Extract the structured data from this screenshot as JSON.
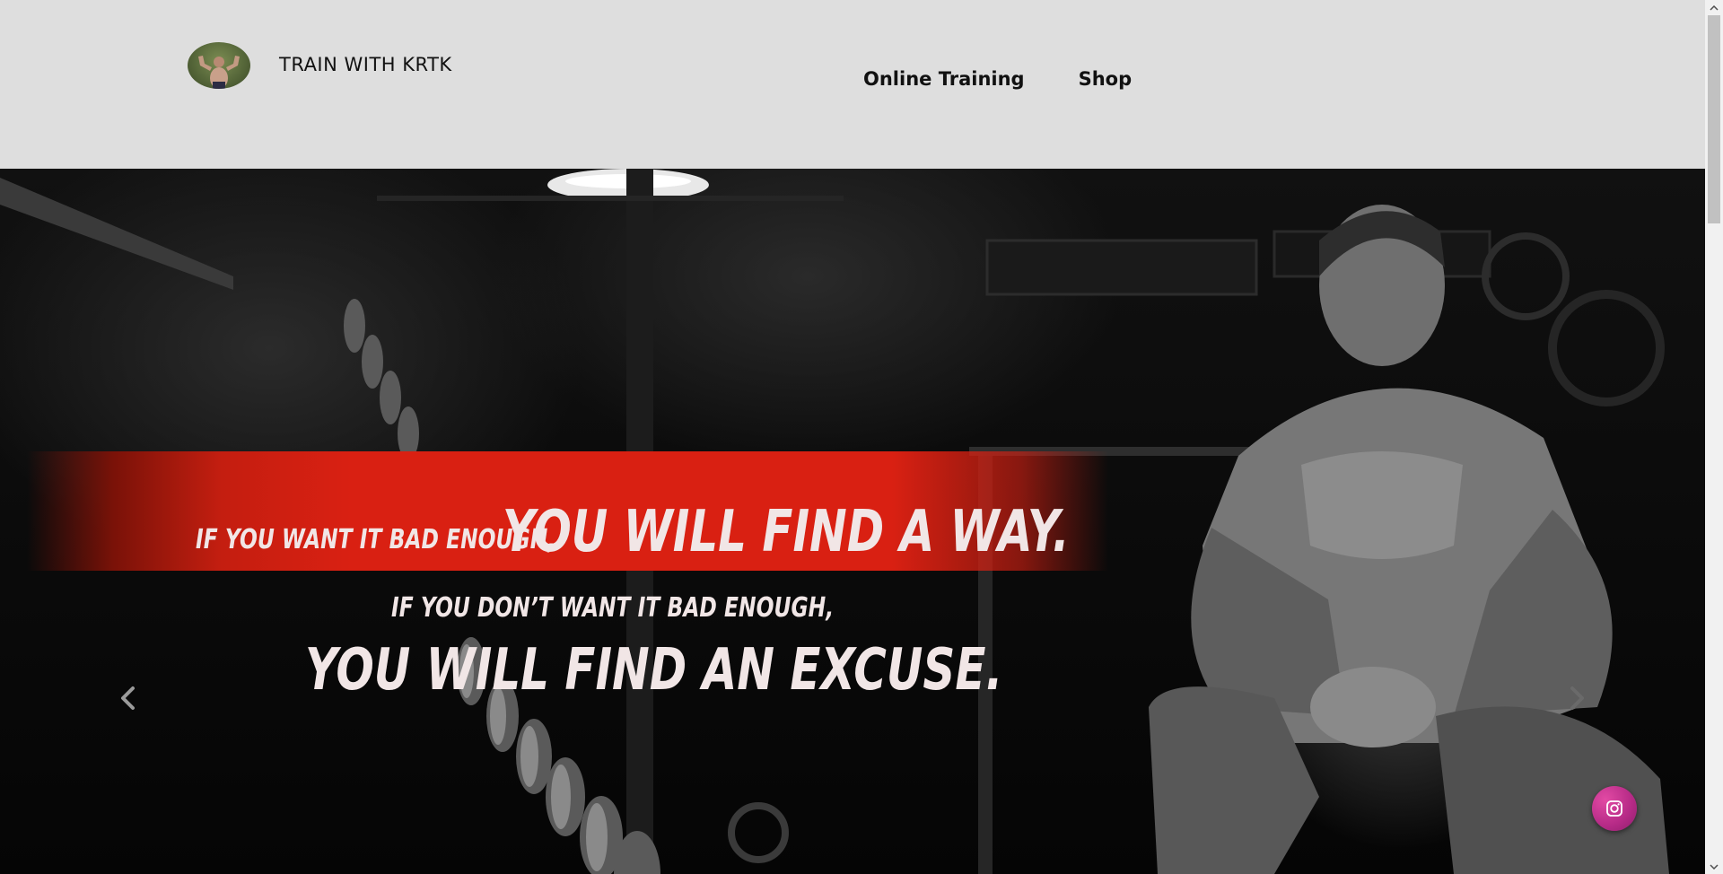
{
  "header": {
    "brand": "TRAIN WITH KRTK",
    "nav": [
      {
        "label": "Online Training"
      },
      {
        "label": "Shop"
      }
    ]
  },
  "hero": {
    "quote_line1_small": "IF YOU WANT IT BAD ENOUGH,",
    "quote_line1_large": "YOU WILL FIND A WAY.",
    "quote_line2_small": "IF YOU DON’T WANT IT BAD ENOUGH,",
    "quote_line2_large": "YOU WILL FIND AN EXCUSE.",
    "prev_icon": "chevron-left-icon",
    "next_icon": "chevron-right-icon",
    "accent_color": "#d92012"
  },
  "social": {
    "instagram_icon": "instagram-icon",
    "button_color": "#c2308f"
  },
  "colors": {
    "header_bg": "#dedede",
    "text": "#111111"
  }
}
